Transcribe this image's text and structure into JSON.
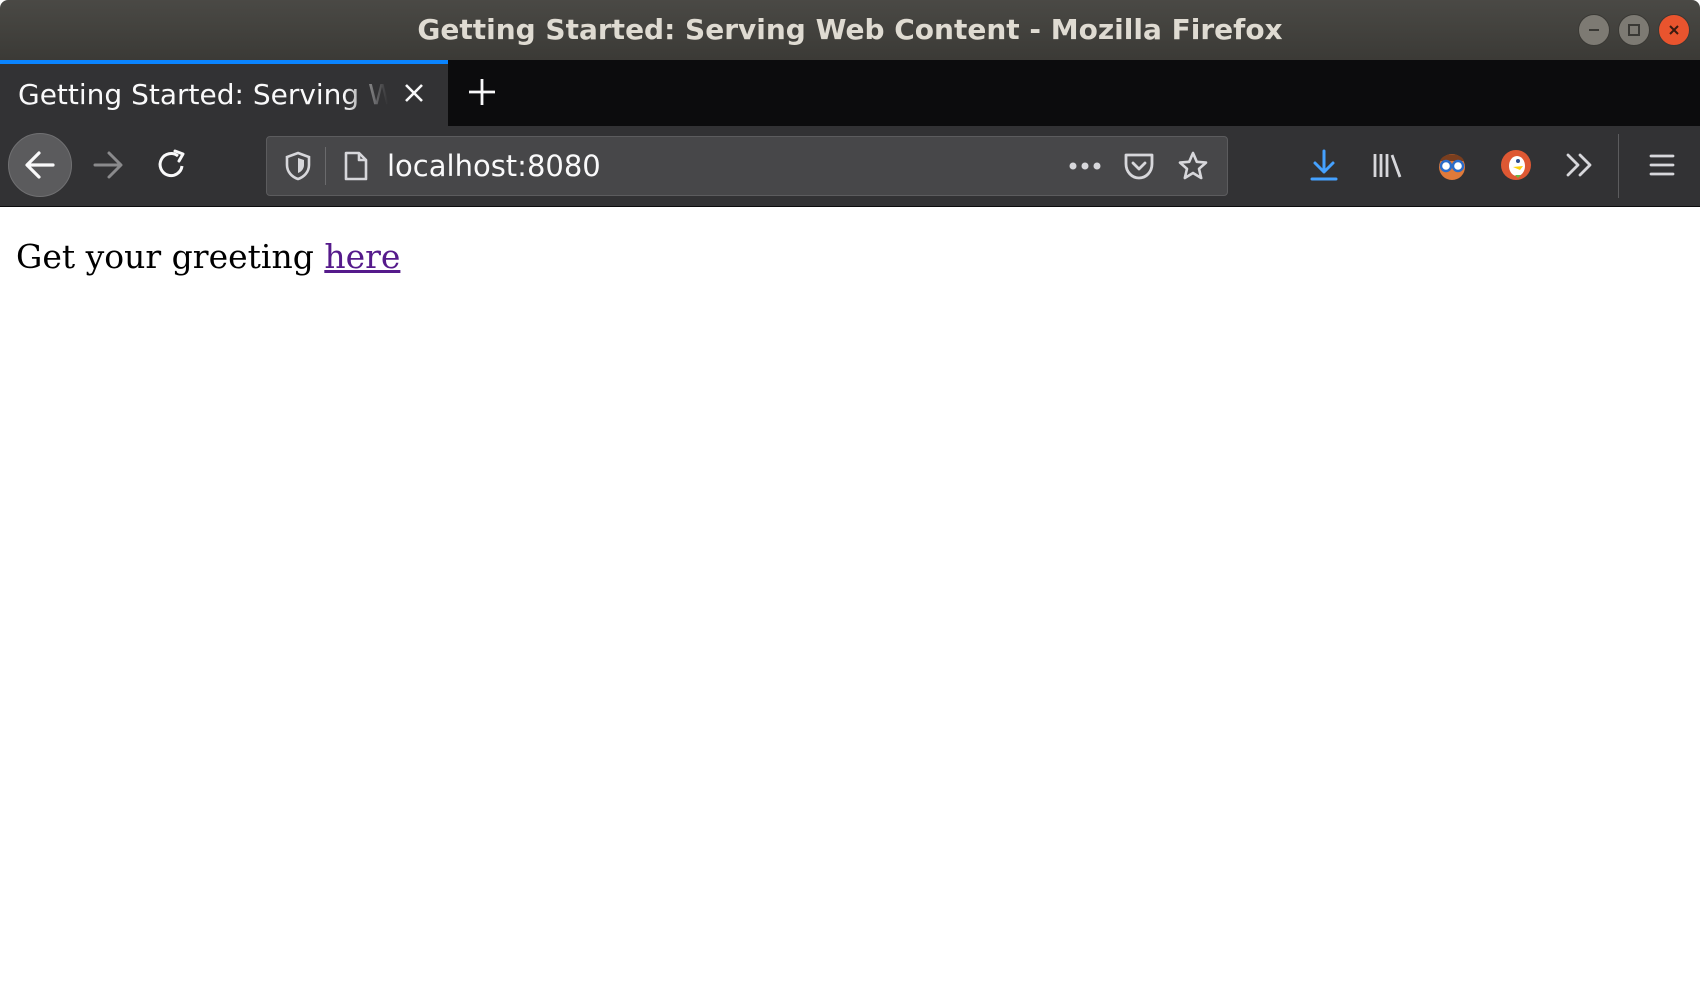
{
  "window": {
    "title": "Getting Started: Serving Web Content - Mozilla Firefox",
    "controls": [
      "minimize-icon",
      "maximize-icon",
      "close-icon"
    ]
  },
  "tabs": [
    {
      "label": "Getting Started: Serving Web Content",
      "active": true
    }
  ],
  "toolbar": {
    "url": "localhost:8080",
    "icons": [
      "back-arrow-icon",
      "forward-arrow-icon",
      "reload-icon",
      "shield-icon",
      "page-icon",
      "more-dots-icon",
      "pocket-icon",
      "bookmark-star-icon",
      "download-icon",
      "library-icon",
      "extension-glasses-icon",
      "duckduckgo-icon",
      "overflow-chevron-icon",
      "hamburger-menu-icon"
    ]
  },
  "page": {
    "text": "Get your greeting ",
    "link_text": "here"
  },
  "colors": {
    "accent": "#0a84ff",
    "visited_link": "#551a8b",
    "toolbar_bg": "#323234",
    "tabstrip_bg": "#0c0c0d"
  }
}
